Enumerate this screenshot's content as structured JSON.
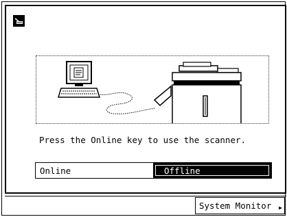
{
  "status": {
    "message": "Press the Online key to use the scanner."
  },
  "toggle": {
    "online_label": "Online",
    "offline_label": "Offline",
    "selected": "Offline"
  },
  "footer": {
    "system_monitor_label": "System Monitor"
  },
  "icons": {
    "mode": "scanner-mode-icon",
    "monitor_arrow": "triangle-right-icon"
  },
  "colors": {
    "foreground": "#000000",
    "background": "#ffffff"
  }
}
